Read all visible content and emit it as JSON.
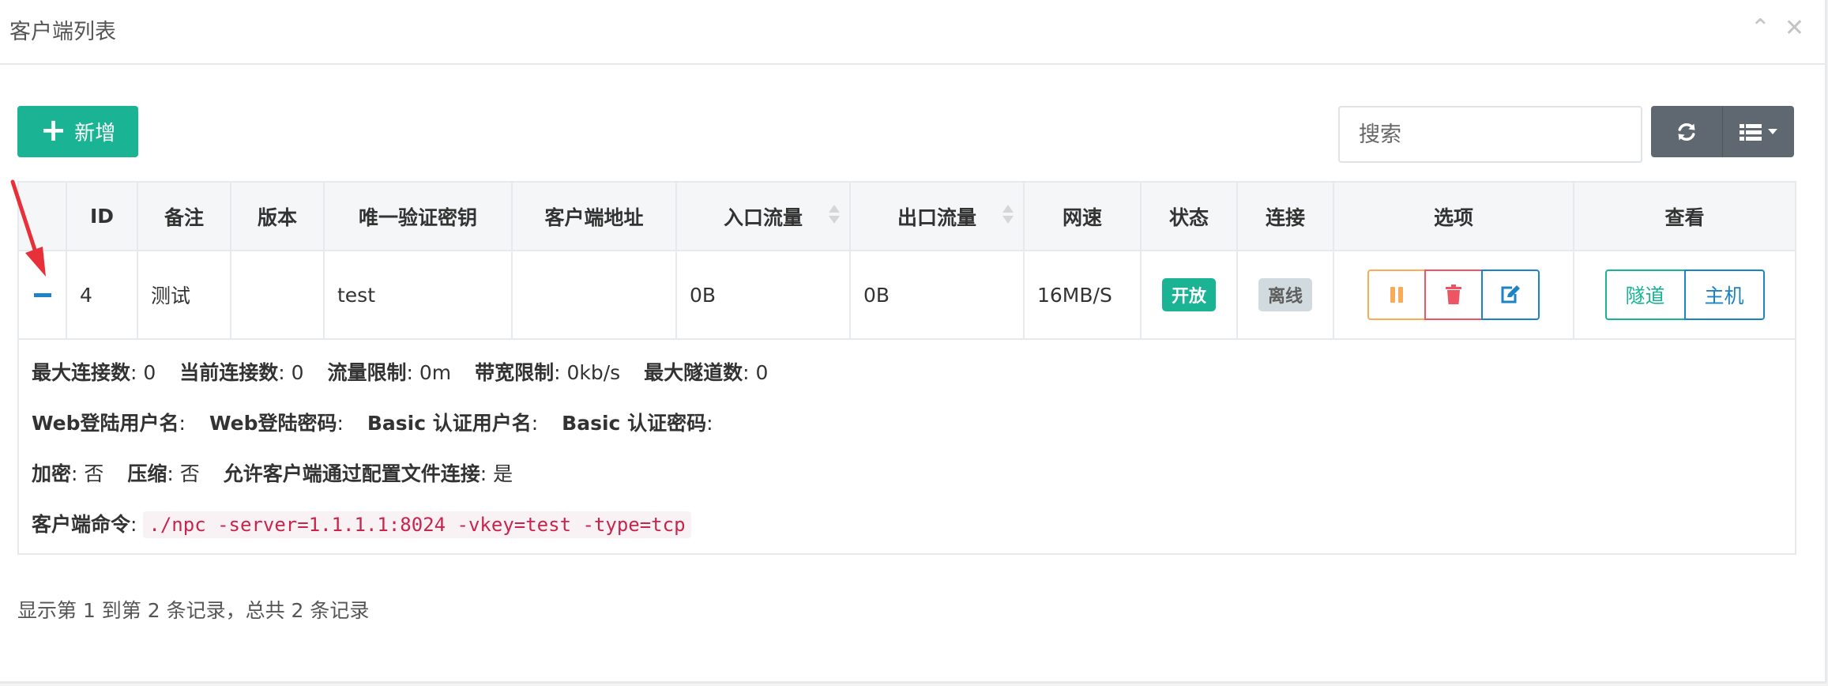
{
  "panel": {
    "title": "客户端列表",
    "collapse_icon": "chevron-up-icon",
    "close_icon": "close-icon"
  },
  "toolbar": {
    "add_label": "新增",
    "search_placeholder": "搜索",
    "refresh_icon": "refresh-icon",
    "columns_icon": "list-icon"
  },
  "table": {
    "headers": {
      "expand": "",
      "id": "ID",
      "remark": "备注",
      "version": "版本",
      "vkey": "唯一验证密钥",
      "addr": "客户端地址",
      "inlet": "入口流量",
      "export": "出口流量",
      "speed": "网速",
      "status": "状态",
      "connect": "连接",
      "options": "选项",
      "view": "查看"
    },
    "rows": [
      {
        "id": "4",
        "remark": "测试",
        "version": "",
        "vkey": "test",
        "addr": "",
        "inlet": "0B",
        "export": "0B",
        "speed": "16MB/S",
        "status": "开放",
        "connect": "离线",
        "view_tunnel": "隧道",
        "view_host": "主机"
      }
    ],
    "detail": {
      "max_conn_label": "最大连接数",
      "max_conn": ": 0",
      "cur_conn_label": "当前连接数",
      "cur_conn": ": 0",
      "flow_limit_label": "流量限制",
      "flow_limit": ": 0m",
      "rate_limit_label": "带宽限制",
      "rate_limit": ": 0kb/s",
      "max_tunnel_label": "最大隧道数",
      "max_tunnel": ": 0",
      "web_user_label": "Web登陆用户名",
      "web_user": ":",
      "web_pass_label": "Web登陆密码",
      "web_pass": ":",
      "basic_user_label": "Basic 认证用户名",
      "basic_user": ":",
      "basic_pass_label": "Basic 认证密码",
      "basic_pass": ":",
      "crypt_label": "加密",
      "crypt": ": 否",
      "compress_label": "压缩",
      "compress": ": 否",
      "config_conn_label": "允许客户端通过配置文件连接",
      "config_conn": ": 是",
      "cmd_label": "客户端命令",
      "cmd_sep": ":",
      "cmd": "./npc -server=1.1.1.1:8024 -vkey=test -type=tcp"
    }
  },
  "pagination": {
    "info": "显示第 1 到第 2 条记录，总共 2 条记录"
  },
  "colors": {
    "primary": "#1ab394",
    "info": "#1c84c6",
    "warning": "#f8ac59",
    "danger": "#ed5565",
    "annotation": "#e8303a"
  }
}
